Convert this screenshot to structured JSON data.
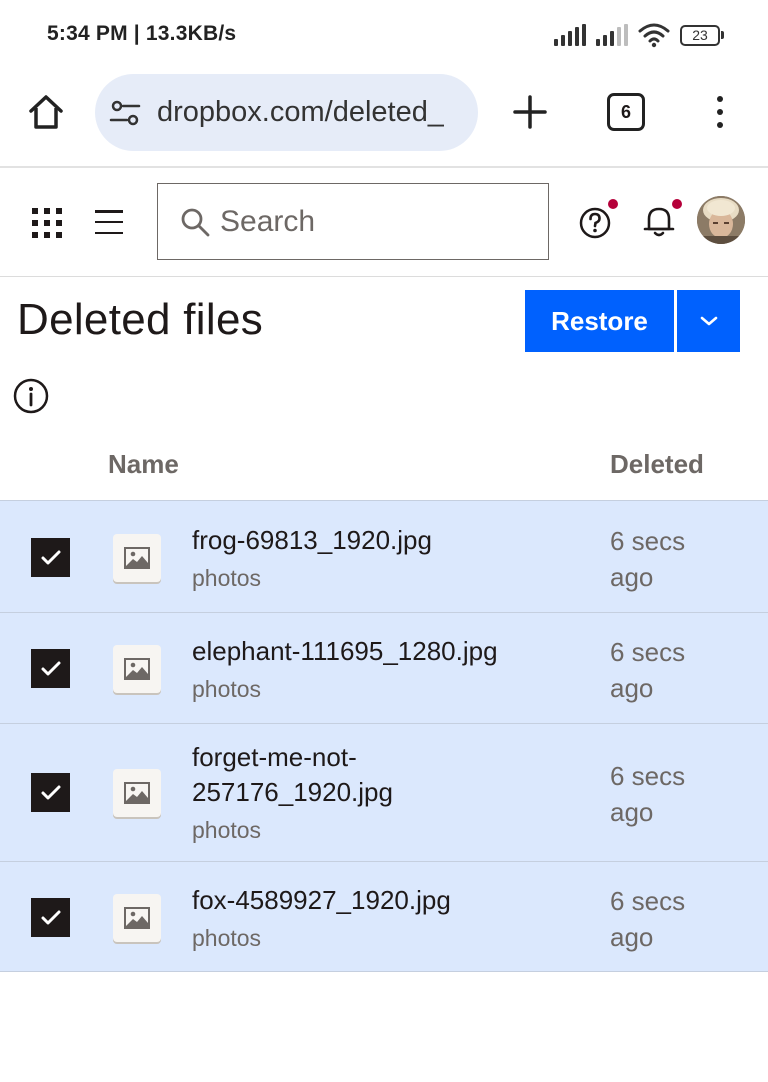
{
  "status_bar": {
    "time_speed": "5:34 PM | 13.3KB/s",
    "battery": "23"
  },
  "browser": {
    "url": "dropbox.com/deleted_",
    "tab_count": "6"
  },
  "header": {
    "search_placeholder": "Search"
  },
  "page": {
    "title": "Deleted files",
    "restore_label": "Restore"
  },
  "table": {
    "col_name": "Name",
    "col_deleted": "Deleted",
    "rows": [
      {
        "name": "frog-69813_1920.jpg",
        "folder": "photos",
        "deleted": "6 secs ago",
        "checked": true
      },
      {
        "name": "elephant-111695_1280.jpg",
        "folder": "photos",
        "deleted": "6 secs ago",
        "checked": true
      },
      {
        "name": "forget-me-not-257176_1920.jpg",
        "folder": "photos",
        "deleted": "6 secs ago",
        "checked": true
      },
      {
        "name": "fox-4589927_1920.jpg",
        "folder": "photos",
        "deleted": "6 secs ago",
        "checked": true
      }
    ]
  },
  "colors": {
    "accent": "#0061fe",
    "selected_row": "#dbe8fd",
    "notification_dot": "#b5003a"
  }
}
